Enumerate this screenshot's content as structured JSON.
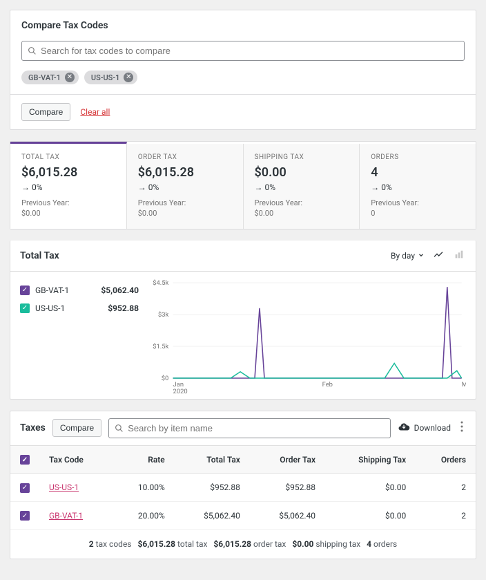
{
  "compare": {
    "title": "Compare Tax Codes",
    "search_placeholder": "Search for tax codes to compare",
    "chips": [
      "GB-VAT-1",
      "US-US-1"
    ],
    "compare_label": "Compare",
    "clear_label": "Clear all"
  },
  "stats": [
    {
      "label": "TOTAL TAX",
      "value": "$6,015.28",
      "delta": "→ 0%",
      "prev_label": "Previous Year:",
      "prev_value": "$0.00",
      "active": true
    },
    {
      "label": "ORDER TAX",
      "value": "$6,015.28",
      "delta": "→ 0%",
      "prev_label": "Previous Year:",
      "prev_value": "$0.00",
      "active": false
    },
    {
      "label": "SHIPPING TAX",
      "value": "$0.00",
      "delta": "→ 0%",
      "prev_label": "Previous Year:",
      "prev_value": "$0.00",
      "active": false
    },
    {
      "label": "ORDERS",
      "value": "4",
      "delta": "→ 0%",
      "prev_label": "Previous Year:",
      "prev_value": "0",
      "active": false
    }
  ],
  "chart_header": {
    "title": "Total Tax",
    "interval": "By day"
  },
  "legend": [
    {
      "name": "GB-VAT-1",
      "value": "$5,062.40",
      "color": "#674399"
    },
    {
      "name": "US-US-1",
      "value": "$952.88",
      "color": "#1abc9c"
    }
  ],
  "chart_data": {
    "type": "line",
    "title": "Total Tax",
    "xlabel": "",
    "ylabel": "",
    "ylim": [
      0,
      4500
    ],
    "y_ticks": [
      "$0",
      "$1.5k",
      "$3k",
      "$4.5k"
    ],
    "x_ticks": [
      "Jan",
      "Feb",
      "Mar"
    ],
    "x_year": "2020",
    "x_range_days": 60,
    "series": [
      {
        "name": "GB-VAT-1",
        "color": "#674399",
        "points": [
          [
            0,
            0
          ],
          [
            17,
            0
          ],
          [
            18,
            3300
          ],
          [
            19,
            0
          ],
          [
            56,
            0
          ],
          [
            57,
            4300
          ],
          [
            58,
            0
          ],
          [
            60,
            0
          ]
        ]
      },
      {
        "name": "US-US-1",
        "color": "#1abc9c",
        "points": [
          [
            0,
            0
          ],
          [
            12,
            0
          ],
          [
            14,
            300
          ],
          [
            16,
            0
          ],
          [
            44,
            0
          ],
          [
            46,
            700
          ],
          [
            48,
            0
          ],
          [
            57,
            0
          ],
          [
            59,
            350
          ],
          [
            60,
            0
          ]
        ]
      }
    ]
  },
  "taxes": {
    "title": "Taxes",
    "compare_label": "Compare",
    "search_placeholder": "Search by item name",
    "download_label": "Download",
    "columns": [
      "Tax Code",
      "Rate",
      "Total Tax",
      "Order Tax",
      "Shipping Tax",
      "Orders"
    ],
    "rows": [
      {
        "code": "US-US-1",
        "rate": "10.00%",
        "total": "$952.88",
        "order": "$952.88",
        "shipping": "$0.00",
        "orders": "2"
      },
      {
        "code": "GB-VAT-1",
        "rate": "20.00%",
        "total": "$5,062.40",
        "order": "$5,062.40",
        "shipping": "$0.00",
        "orders": "2"
      }
    ],
    "footer": [
      {
        "b": "2",
        "t": " tax codes"
      },
      {
        "b": "$6,015.28",
        "t": " total tax"
      },
      {
        "b": "$6,015.28",
        "t": " order tax"
      },
      {
        "b": "$0.00",
        "t": " shipping tax"
      },
      {
        "b": "4",
        "t": " orders"
      }
    ]
  },
  "colors": {
    "accent": "#674399"
  }
}
